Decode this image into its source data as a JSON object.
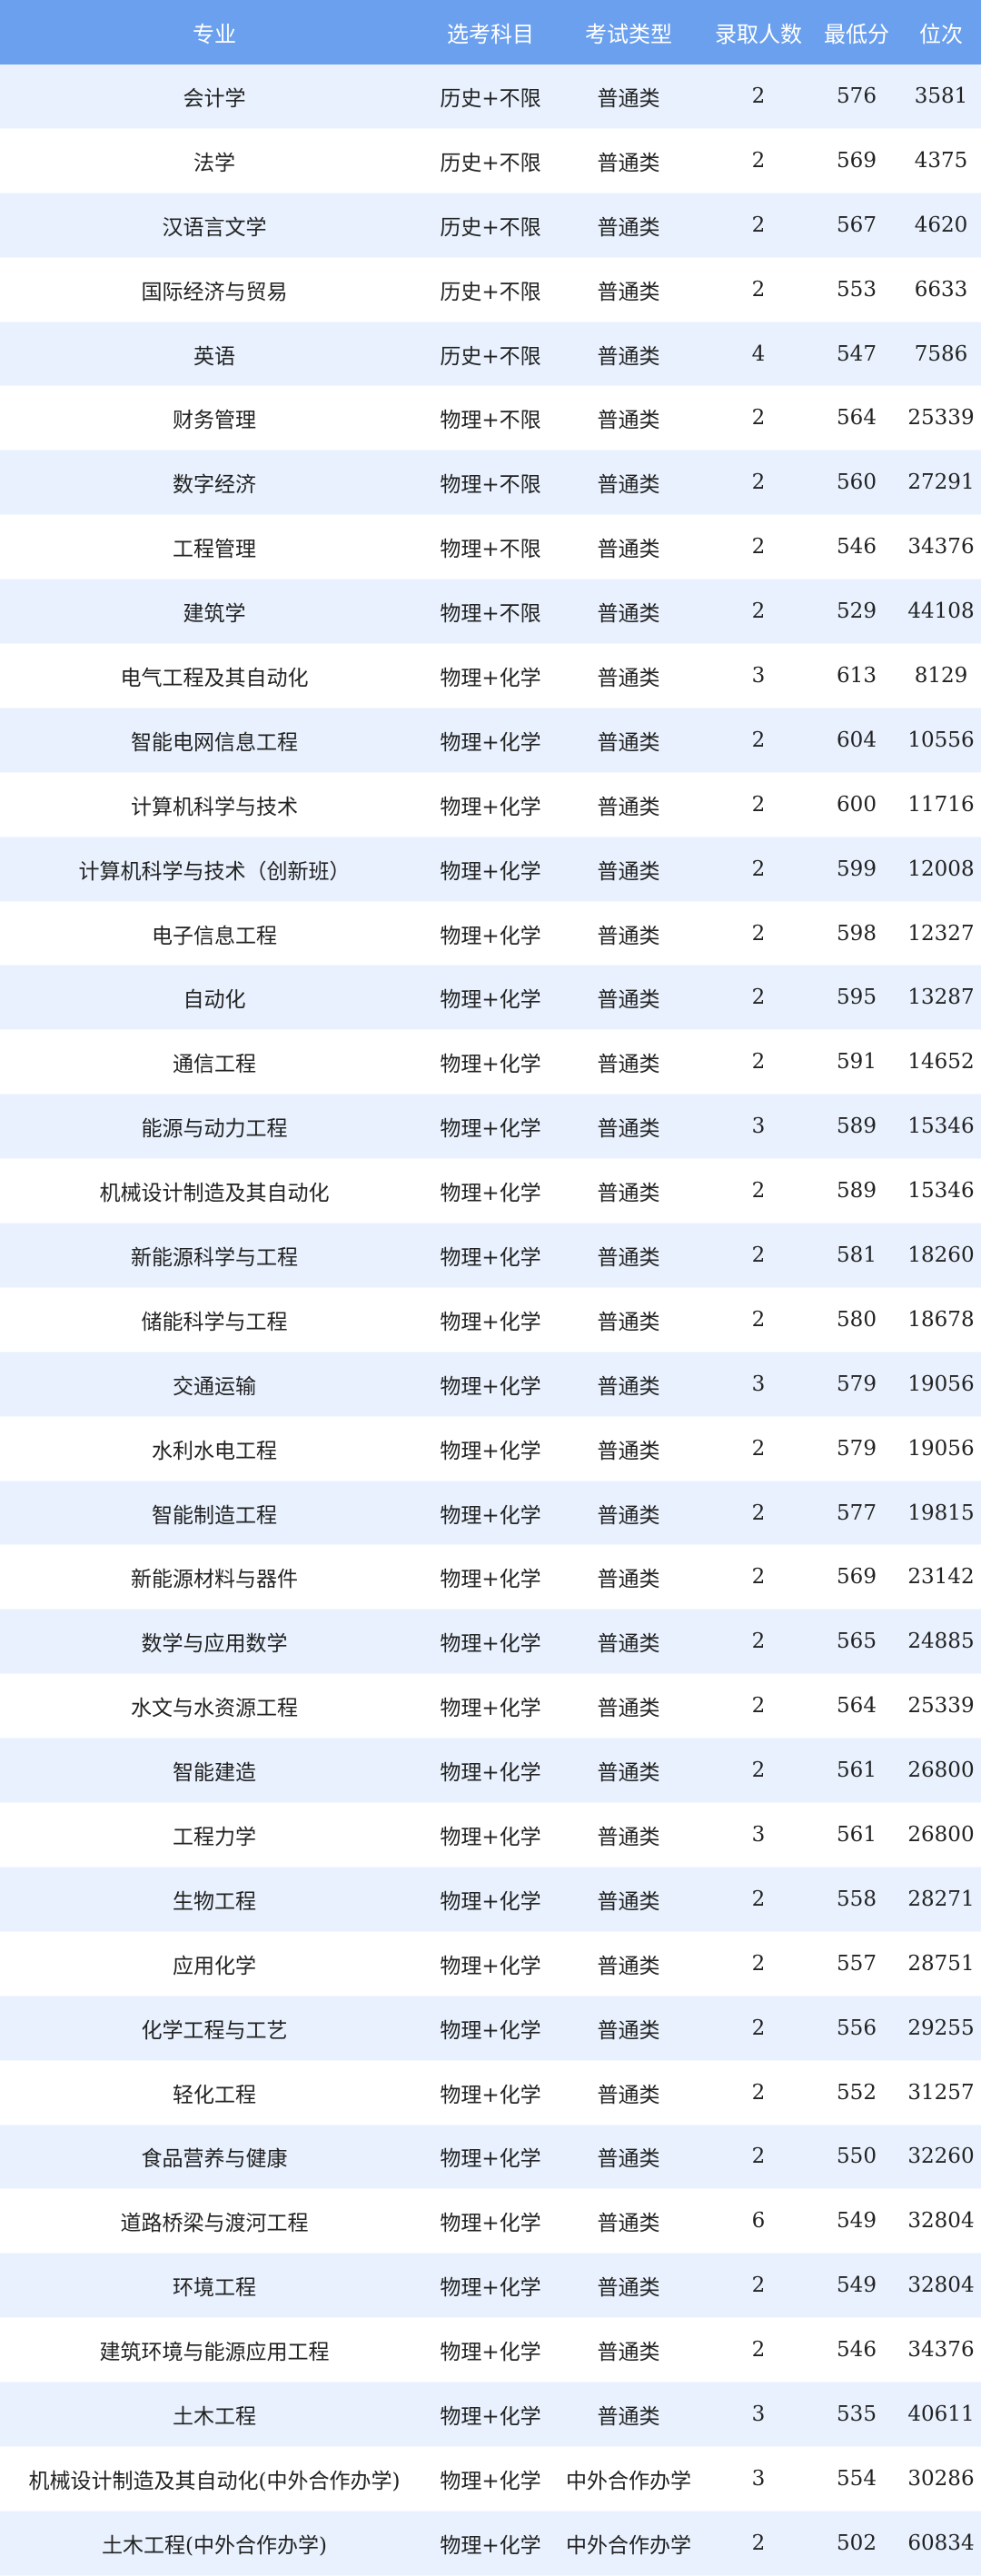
{
  "headers": [
    "专业",
    "选考科目",
    "考试类型",
    "录取人数",
    "最低分",
    "位次"
  ],
  "rows": [
    [
      "会计学",
      "历史+不限",
      "普通类",
      "2",
      "576",
      "3581"
    ],
    [
      "法学",
      "历史+不限",
      "普通类",
      "2",
      "569",
      "4375"
    ],
    [
      "汉语言文学",
      "历史+不限",
      "普通类",
      "2",
      "567",
      "4620"
    ],
    [
      "国际经济与贸易",
      "历史+不限",
      "普通类",
      "2",
      "553",
      "6633"
    ],
    [
      "英语",
      "历史+不限",
      "普通类",
      "4",
      "547",
      "7586"
    ],
    [
      "财务管理",
      "物理+不限",
      "普通类",
      "2",
      "564",
      "25339"
    ],
    [
      "数字经济",
      "物理+不限",
      "普通类",
      "2",
      "560",
      "27291"
    ],
    [
      "工程管理",
      "物理+不限",
      "普通类",
      "2",
      "546",
      "34376"
    ],
    [
      "建筑学",
      "物理+不限",
      "普通类",
      "2",
      "529",
      "44108"
    ],
    [
      "电气工程及其自动化",
      "物理+化学",
      "普通类",
      "3",
      "613",
      "8129"
    ],
    [
      "智能电网信息工程",
      "物理+化学",
      "普通类",
      "2",
      "604",
      "10556"
    ],
    [
      "计算机科学与技术",
      "物理+化学",
      "普通类",
      "2",
      "600",
      "11716"
    ],
    [
      "计算机科学与技术（创新班）",
      "物理+化学",
      "普通类",
      "2",
      "599",
      "12008"
    ],
    [
      "电子信息工程",
      "物理+化学",
      "普通类",
      "2",
      "598",
      "12327"
    ],
    [
      "自动化",
      "物理+化学",
      "普通类",
      "2",
      "595",
      "13287"
    ],
    [
      "通信工程",
      "物理+化学",
      "普通类",
      "2",
      "591",
      "14652"
    ],
    [
      "能源与动力工程",
      "物理+化学",
      "普通类",
      "3",
      "589",
      "15346"
    ],
    [
      "机械设计制造及其自动化",
      "物理+化学",
      "普通类",
      "2",
      "589",
      "15346"
    ],
    [
      "新能源科学与工程",
      "物理+化学",
      "普通类",
      "2",
      "581",
      "18260"
    ],
    [
      "储能科学与工程",
      "物理+化学",
      "普通类",
      "2",
      "580",
      "18678"
    ],
    [
      "交通运输",
      "物理+化学",
      "普通类",
      "3",
      "579",
      "19056"
    ],
    [
      "水利水电工程",
      "物理+化学",
      "普通类",
      "2",
      "579",
      "19056"
    ],
    [
      "智能制造工程",
      "物理+化学",
      "普通类",
      "2",
      "577",
      "19815"
    ],
    [
      "新能源材料与器件",
      "物理+化学",
      "普通类",
      "2",
      "569",
      "23142"
    ],
    [
      "数学与应用数学",
      "物理+化学",
      "普通类",
      "2",
      "565",
      "24885"
    ],
    [
      "水文与水资源工程",
      "物理+化学",
      "普通类",
      "2",
      "564",
      "25339"
    ],
    [
      "智能建造",
      "物理+化学",
      "普通类",
      "2",
      "561",
      "26800"
    ],
    [
      "工程力学",
      "物理+化学",
      "普通类",
      "3",
      "561",
      "26800"
    ],
    [
      "生物工程",
      "物理+化学",
      "普通类",
      "2",
      "558",
      "28271"
    ],
    [
      "应用化学",
      "物理+化学",
      "普通类",
      "2",
      "557",
      "28751"
    ],
    [
      "化学工程与工艺",
      "物理+化学",
      "普通类",
      "2",
      "556",
      "29255"
    ],
    [
      "轻化工程",
      "物理+化学",
      "普通类",
      "2",
      "552",
      "31257"
    ],
    [
      "食品营养与健康",
      "物理+化学",
      "普通类",
      "2",
      "550",
      "32260"
    ],
    [
      "道路桥梁与渡河工程",
      "物理+化学",
      "普通类",
      "6",
      "549",
      "32804"
    ],
    [
      "环境工程",
      "物理+化学",
      "普通类",
      "2",
      "549",
      "32804"
    ],
    [
      "建筑环境与能源应用工程",
      "物理+化学",
      "普通类",
      "2",
      "546",
      "34376"
    ],
    [
      "土木工程",
      "物理+化学",
      "普通类",
      "3",
      "535",
      "40611"
    ],
    [
      "机械设计制造及其自动化(中外合作办学)",
      "物理+化学",
      "中外合作办学",
      "3",
      "554",
      "30286"
    ],
    [
      "土木工程(中外合作办学)",
      "物理+化学",
      "中外合作办学",
      "2",
      "502",
      "60834"
    ]
  ]
}
